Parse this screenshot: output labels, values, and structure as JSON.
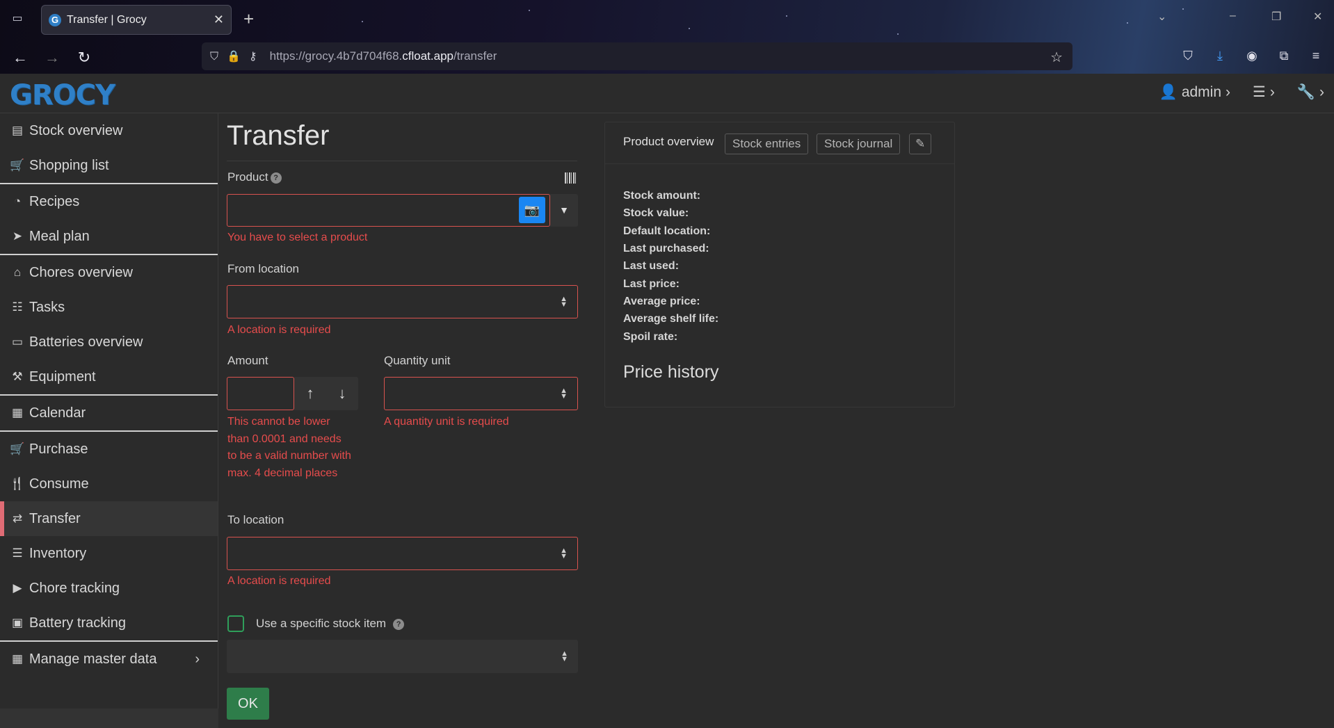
{
  "browser": {
    "tab_title": "Transfer | Grocy",
    "tab_favicon": "G",
    "url_prefix": "https://grocy.4b7d704f68.",
    "url_domain": "cfloat.app",
    "url_path": "/transfer"
  },
  "header": {
    "logo": "GROCY",
    "user": "admin"
  },
  "sidebar": {
    "items": [
      {
        "label": "Stock overview",
        "icon": "box-icon"
      },
      {
        "label": "Shopping list",
        "icon": "cart-icon"
      },
      {
        "label": "Recipes",
        "icon": "pizza-icon"
      },
      {
        "label": "Meal plan",
        "icon": "paper-plane-icon"
      },
      {
        "label": "Chores overview",
        "icon": "home-icon"
      },
      {
        "label": "Tasks",
        "icon": "tasks-icon"
      },
      {
        "label": "Batteries overview",
        "icon": "battery-icon"
      },
      {
        "label": "Equipment",
        "icon": "toolbox-icon"
      },
      {
        "label": "Calendar",
        "icon": "calendar-icon"
      },
      {
        "label": "Purchase",
        "icon": "cart-plus-icon"
      },
      {
        "label": "Consume",
        "icon": "utensils-icon"
      },
      {
        "label": "Transfer",
        "icon": "exchange-icon"
      },
      {
        "label": "Inventory",
        "icon": "list-icon"
      },
      {
        "label": "Chore tracking",
        "icon": "play-icon"
      },
      {
        "label": "Battery tracking",
        "icon": "car-battery-icon"
      },
      {
        "label": "Manage master data",
        "icon": "table-icon"
      }
    ]
  },
  "form": {
    "title": "Transfer",
    "product_label": "Product",
    "product_error": "You have to select a product",
    "from_location_label": "From location",
    "from_location_error": "A location is required",
    "amount_label": "Amount",
    "amount_error": "This cannot be lower than 0.0001 and needs to be a valid number with max. 4 decimal places",
    "qu_label": "Quantity unit",
    "qu_error": "A quantity unit is required",
    "to_location_label": "To location",
    "to_location_error": "A location is required",
    "specific_stock_label": "Use a specific stock item",
    "ok_label": "OK"
  },
  "card": {
    "tab_overview": "Product overview",
    "tab_entries": "Stock entries",
    "tab_journal": "Stock journal",
    "stats": [
      "Stock amount:",
      "Stock value:",
      "Default location:",
      "Last purchased:",
      "Last used:",
      "Last price:",
      "Average price:",
      "Average shelf life:",
      "Spoil rate:"
    ],
    "price_history": "Price history"
  },
  "colors": {
    "error": "#e64c4c",
    "accent": "#1a86f2",
    "active_marker": "#e06c75",
    "ok": "#2e7d4a"
  }
}
